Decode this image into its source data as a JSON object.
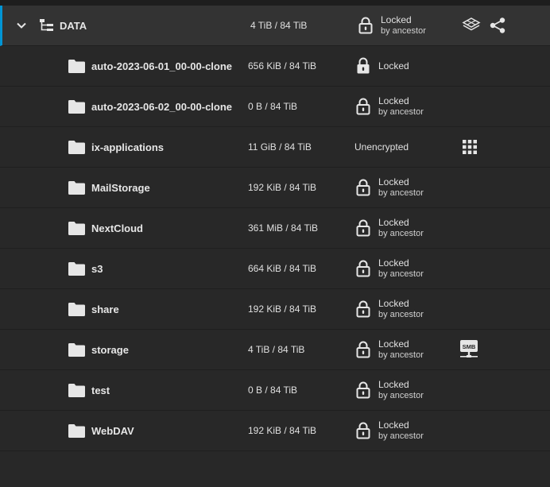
{
  "root": {
    "name": "DATA",
    "used": "4 TiB / 84 TiB",
    "encryption": "Locked",
    "encryption_sub": "by ancestor",
    "icons": [
      "chevron-down-icon",
      "tree-structure-icon",
      "lock-icon",
      "kubernetes-icon",
      "share-icon"
    ]
  },
  "children": [
    {
      "name": "auto-2023-06-01_00-00-clone",
      "used": "656 KiB / 84 TiB",
      "encryption": "Locked",
      "encryption_sub": ""
    },
    {
      "name": "auto-2023-06-02_00-00-clone",
      "used": "0 B / 84 TiB",
      "encryption": "Locked",
      "encryption_sub": "by ancestor"
    },
    {
      "name": "ix-applications",
      "used": "11 GiB / 84 TiB",
      "encryption": "Unencrypted",
      "encryption_sub": "",
      "role_icon": "apps-grid-icon"
    },
    {
      "name": "MailStorage",
      "used": "192 KiB / 84 TiB",
      "encryption": "Locked",
      "encryption_sub": "by ancestor"
    },
    {
      "name": "NextCloud",
      "used": "361 MiB / 84 TiB",
      "encryption": "Locked",
      "encryption_sub": "by ancestor"
    },
    {
      "name": "s3",
      "used": "664 KiB / 84 TiB",
      "encryption": "Locked",
      "encryption_sub": "by ancestor"
    },
    {
      "name": "share",
      "used": "192 KiB / 84 TiB",
      "encryption": "Locked",
      "encryption_sub": "by ancestor"
    },
    {
      "name": "storage",
      "used": "4 TiB / 84 TiB",
      "encryption": "Locked",
      "encryption_sub": "by ancestor",
      "role_icon": "smb-share-icon",
      "role_label": "SMB"
    },
    {
      "name": "test",
      "used": "0 B / 84 TiB",
      "encryption": "Locked",
      "encryption_sub": "by ancestor"
    },
    {
      "name": "WebDAV",
      "used": "192 KiB / 84 TiB",
      "encryption": "Locked",
      "encryption_sub": "by ancestor"
    }
  ],
  "colors": {
    "accent": "#0095d5",
    "background": "#282828",
    "root_row": "#333333",
    "text": "#e6e6e6"
  }
}
